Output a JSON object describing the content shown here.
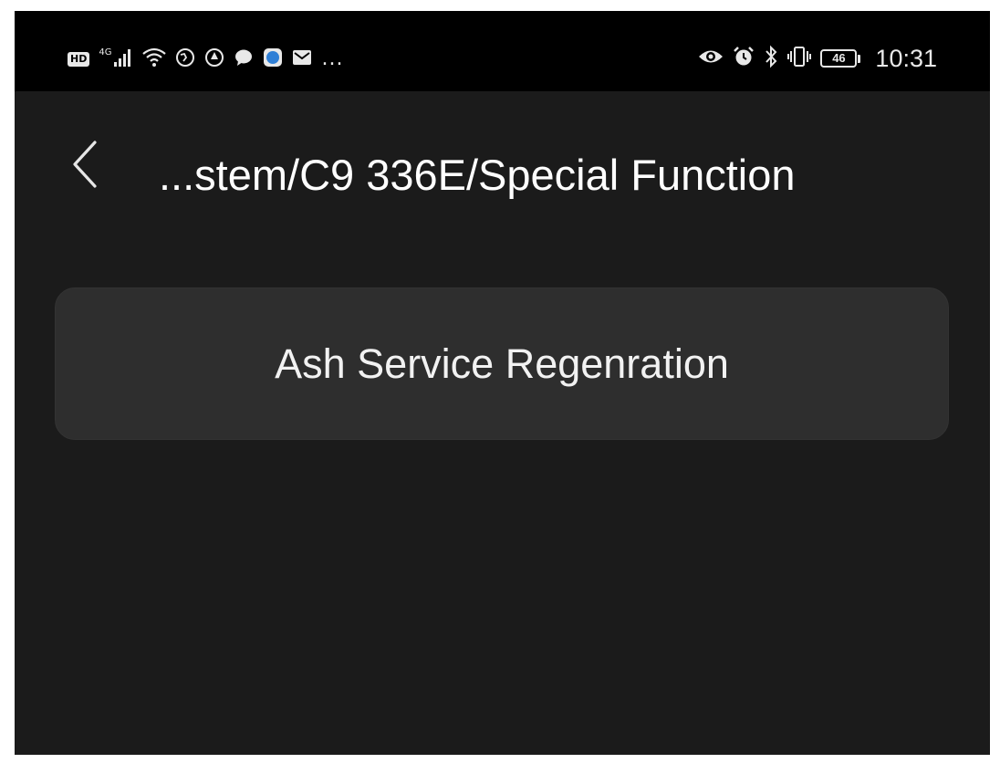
{
  "status_bar": {
    "left_items": [
      {
        "kind": "badge",
        "text": "HD",
        "icon": "hd-icon"
      },
      {
        "kind": "text",
        "text": "4G",
        "icon": "network-type-icon"
      },
      {
        "kind": "icon",
        "icon": "signal-icon"
      },
      {
        "kind": "icon",
        "icon": "wifi-icon"
      },
      {
        "kind": "icon",
        "icon": "globe-app-icon"
      },
      {
        "kind": "icon",
        "icon": "app-notification-icon"
      },
      {
        "kind": "icon",
        "icon": "chat-bubble-icon"
      },
      {
        "kind": "icon",
        "icon": "app-blue-icon"
      },
      {
        "kind": "icon",
        "icon": "mail-icon"
      },
      {
        "kind": "text",
        "text": "...",
        "icon": "more-notifications-icon"
      }
    ],
    "right_icons": [
      "eye-icon",
      "alarm-icon",
      "bluetooth-icon",
      "vibrate-icon"
    ],
    "battery_level": "46",
    "time": "10:31"
  },
  "header": {
    "title": "...stem/C9 336E/Special Function",
    "back_icon": "chevron-left-icon"
  },
  "actions": [
    {
      "label": "Ash Service Regenration"
    }
  ],
  "colors": {
    "background": "#1b1b1b",
    "status_bar": "#000000",
    "card": "#2e2e2e",
    "text": "#ffffff"
  }
}
